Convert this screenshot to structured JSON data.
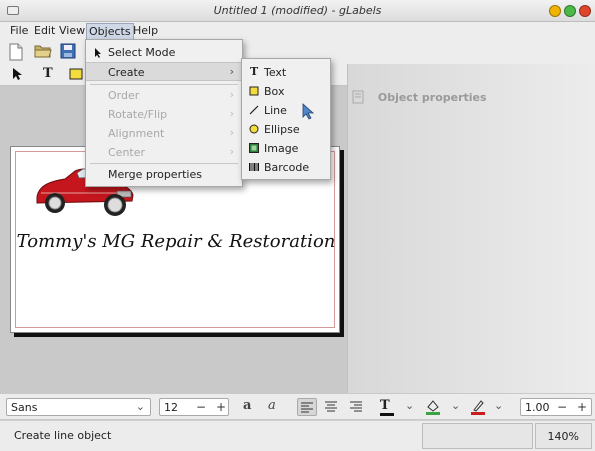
{
  "window": {
    "title": "Untitled 1 (modified) - gLabels",
    "controls": {
      "minimize_color": "#f0b400",
      "maximize_color": "#4cb848",
      "close_color": "#e0442c"
    }
  },
  "menubar": {
    "items": [
      "File",
      "Edit",
      "View",
      "Objects",
      "Help"
    ],
    "active": "Objects"
  },
  "objects_menu": {
    "items": [
      {
        "label": "Select Mode",
        "icon": "arrow-pointer-icon",
        "disabled": false,
        "submenu": false
      },
      {
        "label": "Create",
        "disabled": false,
        "submenu": true,
        "highlighted": true
      },
      {
        "label": "Order",
        "disabled": true,
        "submenu": true
      },
      {
        "label": "Rotate/Flip",
        "disabled": true,
        "submenu": true
      },
      {
        "label": "Alignment",
        "disabled": true,
        "submenu": true
      },
      {
        "label": "Center",
        "disabled": true,
        "submenu": true
      },
      {
        "label": "Merge properties",
        "disabled": false,
        "submenu": false
      }
    ]
  },
  "create_submenu": {
    "items": [
      {
        "label": "Text",
        "icon": "text-icon"
      },
      {
        "label": "Box",
        "icon": "box-icon"
      },
      {
        "label": "Line",
        "icon": "line-icon"
      },
      {
        "label": "Ellipse",
        "icon": "ellipse-icon"
      },
      {
        "label": "Image",
        "icon": "image-icon"
      },
      {
        "label": "Barcode",
        "icon": "barcode-icon"
      }
    ]
  },
  "right_panel": {
    "title": "Object properties"
  },
  "label": {
    "text": "Tommy's MG Repair & Restoration",
    "border_color": "#d49a9a"
  },
  "format_bar": {
    "font_family": "Sans",
    "font_size": "12",
    "line_width": "1.00"
  },
  "statusbar": {
    "message": "Create line object",
    "zoom": "140%"
  }
}
